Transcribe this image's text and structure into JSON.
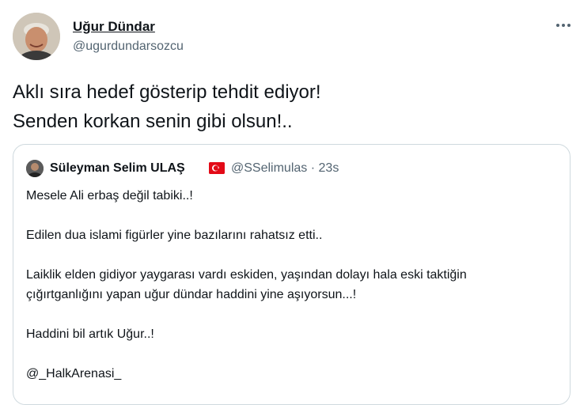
{
  "tweet": {
    "author_name": "Uğur Dündar",
    "author_handle": "@ugurdundarsozcu",
    "text": "Aklı sıra hedef gösterip tehdit ediyor!\nSenden korkan senin gibi olsun!..",
    "more_icon": "more-horizontal-icon"
  },
  "quote": {
    "author_name": "Süleyman Selim ULAŞ",
    "flag_icon": "turkey-flag-icon",
    "author_handle": "@SSelimulas",
    "separator": "·",
    "time": "23s",
    "lines": [
      "Mesele Ali erbaş değil tabiki..!",
      "Edilen dua islami figürler yine bazılarını rahatsız etti..",
      "Laiklik elden gidiyor yaygarası vardı eskiden, yaşından dolayı hala eski taktiğin",
      "çığırtganlığını yapan uğur dündar haddini yine aşıyorsun...!",
      "Haddini bil artık Uğur..!",
      "@_HalkArenasi_"
    ]
  },
  "colors": {
    "text_primary": "#0f1419",
    "text_secondary": "#536471",
    "border": "#cfd9de",
    "flag_red": "#e30a17"
  }
}
